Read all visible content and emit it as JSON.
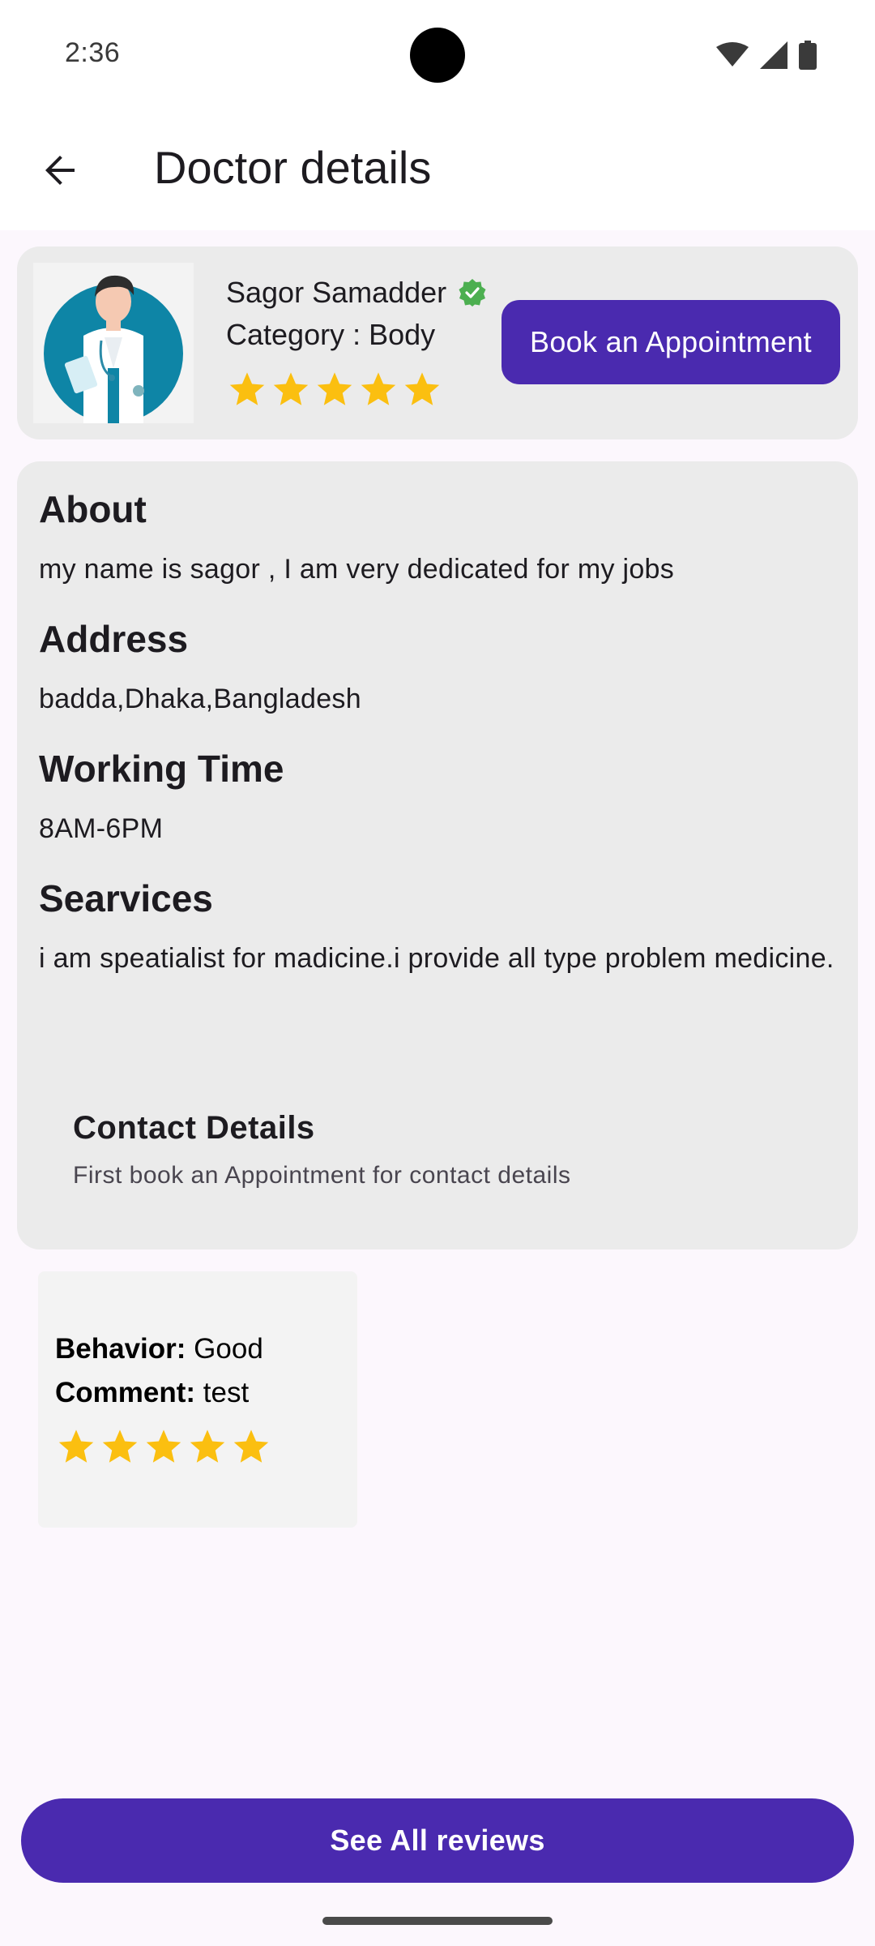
{
  "status_bar": {
    "time": "2:36",
    "icons": [
      "wifi-icon",
      "signal-icon",
      "battery-icon"
    ]
  },
  "app_bar": {
    "title": "Doctor details",
    "back_icon": "arrow-back-icon"
  },
  "doctor": {
    "name": "Sagor Samadder",
    "category": "Category : Body",
    "rating": 5,
    "rating_max": 5,
    "verified": true,
    "book_label": "Book an Appointment"
  },
  "details": {
    "about_title": "About",
    "about_text": "my name is sagor , I am very dedicated for my jobs",
    "address_title": "Address",
    "address_text": "badda,Dhaka,Bangladesh",
    "working_title": "Working Time",
    "working_text": "8AM-6PM",
    "services_title": "Searvices",
    "services_text": "i am speatialist for madicine.i provide all type problem medicine.",
    "contact_title": "Contact Details",
    "contact_sub": "First book an Appointment for contact details"
  },
  "review": {
    "behavior_label": "Behavior:",
    "behavior_value": "Good",
    "comment_label": "Comment:",
    "comment_value": "test",
    "rating": 5,
    "rating_max": 5
  },
  "footer": {
    "see_all_label": "See All reviews"
  },
  "colors": {
    "primary": "#4a2aaf",
    "star": "#fbbf10",
    "verified": "#4caf50",
    "card": "#ebebeb",
    "background": "#fcf7fd"
  }
}
